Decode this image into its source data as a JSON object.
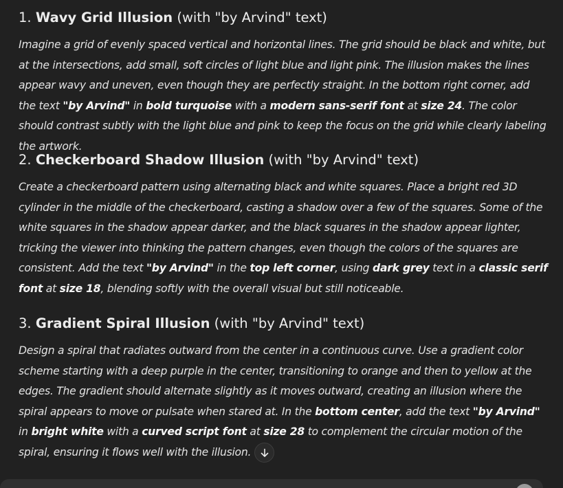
{
  "sections": [
    {
      "number": "1.",
      "title": "Wavy Grid Illusion",
      "suffix": "(with \"by Arvind\" text)",
      "body": {
        "t1": "Imagine a grid of evenly spaced vertical and horizontal lines. The grid should be black and white, but at the intersections, add small, soft circles of light blue and light pink. The illusion makes the lines appear wavy and uneven, even though they are perfectly straight. In the bottom right corner, add the text ",
        "b1": "\"by Arvind\"",
        "t2": " in ",
        "b2": "bold turquoise",
        "t3": " with a ",
        "b3": "modern sans-serif font",
        "t4": " at ",
        "b4": "size 24",
        "t5": ". The color should contrast subtly with the light blue and pink to keep the focus on the grid while clearly labeling the artwork."
      }
    },
    {
      "number": "2.",
      "title": "Checkerboard Shadow Illusion",
      "suffix": "(with \"by Arvind\" text)",
      "body": {
        "t1": "Create a checkerboard pattern using alternating black and white squares. Place a bright red 3D cylinder in the middle of the checkerboard, casting a shadow over a few of the squares. Some of the white squares in the shadow appear darker, and the black squares in the shadow appear lighter, tricking the viewer into thinking the pattern changes, even though the colors of the squares are consistent. Add the text ",
        "b1": "\"by Arvind\"",
        "t2": " in the ",
        "b2": "top left corner",
        "t3": ", using ",
        "b3": "dark grey",
        "t4": " text in a ",
        "b4": "classic serif font",
        "t5": " at ",
        "b5": "size 18",
        "t6": ", blending softly with the overall visual but still noticeable."
      }
    },
    {
      "number": "3.",
      "title": "Gradient Spiral Illusion",
      "suffix": "(with \"by Arvind\" text)",
      "body": {
        "t1": "Design a spiral that radiates outward from the center in a continuous curve. Use a gradient color scheme starting with a deep purple in the center, transitioning to orange and then to yellow at the edges. The gradient should alternate slightly as it moves outward, creating an illusion where the spiral appears to move or pulsate when stared at. In the ",
        "b1": "bottom center",
        "t2": ", add the text ",
        "b2": "\"by Arvind\"",
        "t3": " in ",
        "b3": "bright white",
        "t4": " with a ",
        "b4": "curved script font",
        "t5": " at ",
        "b5": "size 28",
        "t6": " to complement the circular motion of the spiral, ensuring it flows well with the illusion."
      }
    }
  ],
  "icons": {
    "scroll_down": "arrow-down-icon"
  },
  "colors": {
    "background": "#212121",
    "text": "#ececec",
    "composer": "#2f2f2f"
  }
}
